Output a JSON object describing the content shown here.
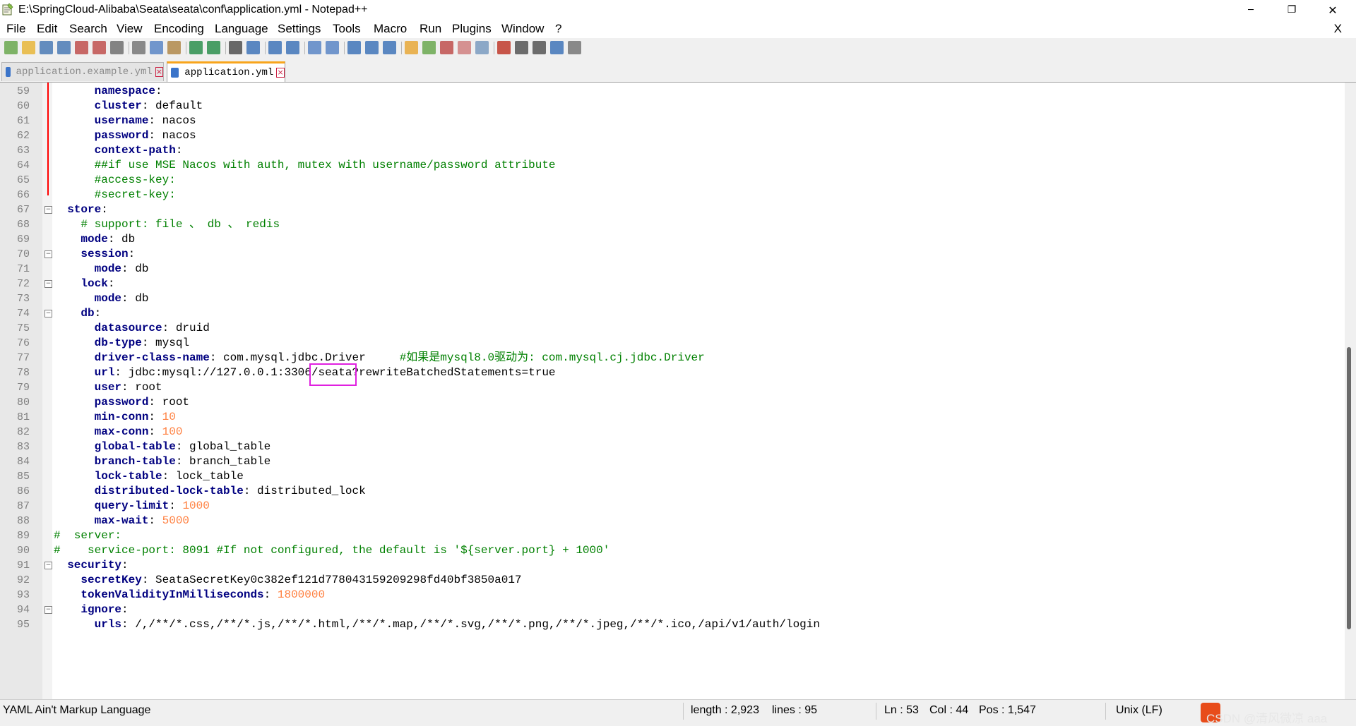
{
  "window": {
    "title": "E:\\SpringCloud-Alibaba\\Seata\\seata\\conf\\application.yml - Notepad++",
    "minimize_glyph": "─",
    "restore_glyph": "❐",
    "close_glyph": "✕"
  },
  "menu": {
    "items": [
      "File",
      "Edit",
      "Search",
      "View",
      "Encoding",
      "Language",
      "Settings",
      "Tools",
      "Macro",
      "Run",
      "Plugins",
      "Window",
      "?"
    ],
    "close_label": "X"
  },
  "toolbar": {
    "icons": [
      "new-file-icon",
      "open-file-icon",
      "save-icon",
      "save-all-icon",
      "close-icon",
      "close-all-icon",
      "print-icon",
      "cut-icon",
      "copy-icon",
      "paste-icon",
      "undo-icon",
      "redo-icon",
      "find-icon",
      "replace-icon",
      "zoom-in-icon",
      "zoom-out-icon",
      "sync-vertical-icon",
      "sync-horizontal-icon",
      "word-wrap-icon",
      "show-all-chars-icon",
      "indent-guide-icon",
      "user-language-icon",
      "document-map-icon",
      "function-list-icon",
      "folder-workspace-icon",
      "monitoring-icon",
      "record-macro-icon",
      "stop-macro-icon",
      "play-macro-icon",
      "run-macro-multiple-icon",
      "save-macro-icon"
    ]
  },
  "tabs": [
    {
      "label": "application.example.yml",
      "active": false
    },
    {
      "label": "application.yml",
      "active": true
    }
  ],
  "tab_close_glyph": "×",
  "fold_minus": "−",
  "lines": [
    {
      "n": "59",
      "segs": [
        {
          "t": "      "
        },
        {
          "t": "namespace",
          "c": "k"
        },
        {
          "t": ":"
        }
      ]
    },
    {
      "n": "60",
      "segs": [
        {
          "t": "      "
        },
        {
          "t": "cluster",
          "c": "k"
        },
        {
          "t": ": default"
        }
      ]
    },
    {
      "n": "61",
      "segs": [
        {
          "t": "      "
        },
        {
          "t": "username",
          "c": "k"
        },
        {
          "t": ": nacos"
        }
      ]
    },
    {
      "n": "62",
      "segs": [
        {
          "t": "      "
        },
        {
          "t": "password",
          "c": "k"
        },
        {
          "t": ": nacos"
        }
      ]
    },
    {
      "n": "63",
      "segs": [
        {
          "t": "      "
        },
        {
          "t": "context-path",
          "c": "k"
        },
        {
          "t": ":"
        }
      ]
    },
    {
      "n": "64",
      "segs": [
        {
          "t": "      "
        },
        {
          "t": "##if use MSE Nacos with auth, mutex with username/password attribute",
          "c": "c"
        }
      ]
    },
    {
      "n": "65",
      "segs": [
        {
          "t": "      "
        },
        {
          "t": "#access-key:",
          "c": "c"
        }
      ]
    },
    {
      "n": "66",
      "segs": [
        {
          "t": "      "
        },
        {
          "t": "#secret-key:",
          "c": "c"
        }
      ]
    },
    {
      "n": "67",
      "segs": [
        {
          "t": "  "
        },
        {
          "t": "store",
          "c": "k"
        },
        {
          "t": ":"
        }
      ]
    },
    {
      "n": "68",
      "segs": [
        {
          "t": "    "
        },
        {
          "t": "# support: file 、 db 、 redis",
          "c": "c"
        }
      ]
    },
    {
      "n": "69",
      "segs": [
        {
          "t": "    "
        },
        {
          "t": "mode",
          "c": "k"
        },
        {
          "t": ": db"
        }
      ]
    },
    {
      "n": "70",
      "segs": [
        {
          "t": "    "
        },
        {
          "t": "session",
          "c": "k"
        },
        {
          "t": ":"
        }
      ]
    },
    {
      "n": "71",
      "segs": [
        {
          "t": "      "
        },
        {
          "t": "mode",
          "c": "k"
        },
        {
          "t": ": db"
        }
      ]
    },
    {
      "n": "72",
      "segs": [
        {
          "t": "    "
        },
        {
          "t": "lock",
          "c": "k"
        },
        {
          "t": ":"
        }
      ]
    },
    {
      "n": "73",
      "segs": [
        {
          "t": "      "
        },
        {
          "t": "mode",
          "c": "k"
        },
        {
          "t": ": db"
        }
      ]
    },
    {
      "n": "74",
      "segs": [
        {
          "t": "    "
        },
        {
          "t": "db",
          "c": "k"
        },
        {
          "t": ":"
        }
      ]
    },
    {
      "n": "75",
      "segs": [
        {
          "t": "      "
        },
        {
          "t": "datasource",
          "c": "k"
        },
        {
          "t": ": druid"
        }
      ]
    },
    {
      "n": "76",
      "segs": [
        {
          "t": "      "
        },
        {
          "t": "db-type",
          "c": "k"
        },
        {
          "t": ": mysql"
        }
      ]
    },
    {
      "n": "77",
      "segs": [
        {
          "t": "      "
        },
        {
          "t": "driver-class-name",
          "c": "k"
        },
        {
          "t": ": com.mysql.jdbc.Driver     "
        },
        {
          "t": "#如果是mysql8.0驱动为: com.mysql.cj.jdbc.Driver",
          "c": "c"
        }
      ]
    },
    {
      "n": "78",
      "segs": [
        {
          "t": "      "
        },
        {
          "t": "url",
          "c": "k"
        },
        {
          "t": ": jdbc:mysql://127.0.0.1:3306/seata?rewriteBatchedStatements=true"
        }
      ]
    },
    {
      "n": "79",
      "segs": [
        {
          "t": "      "
        },
        {
          "t": "user",
          "c": "k"
        },
        {
          "t": ": root"
        }
      ]
    },
    {
      "n": "80",
      "segs": [
        {
          "t": "      "
        },
        {
          "t": "password",
          "c": "k"
        },
        {
          "t": ": root"
        }
      ]
    },
    {
      "n": "81",
      "segs": [
        {
          "t": "      "
        },
        {
          "t": "min-conn",
          "c": "k"
        },
        {
          "t": ": "
        },
        {
          "t": "10",
          "c": "n"
        }
      ]
    },
    {
      "n": "82",
      "segs": [
        {
          "t": "      "
        },
        {
          "t": "max-conn",
          "c": "k"
        },
        {
          "t": ": "
        },
        {
          "t": "100",
          "c": "n"
        }
      ]
    },
    {
      "n": "83",
      "segs": [
        {
          "t": "      "
        },
        {
          "t": "global-table",
          "c": "k"
        },
        {
          "t": ": global_table"
        }
      ]
    },
    {
      "n": "84",
      "segs": [
        {
          "t": "      "
        },
        {
          "t": "branch-table",
          "c": "k"
        },
        {
          "t": ": branch_table"
        }
      ]
    },
    {
      "n": "85",
      "segs": [
        {
          "t": "      "
        },
        {
          "t": "lock-table",
          "c": "k"
        },
        {
          "t": ": lock_table"
        }
      ]
    },
    {
      "n": "86",
      "segs": [
        {
          "t": "      "
        },
        {
          "t": "distributed-lock-table",
          "c": "k"
        },
        {
          "t": ": distributed_lock"
        }
      ]
    },
    {
      "n": "87",
      "segs": [
        {
          "t": "      "
        },
        {
          "t": "query-limit",
          "c": "k"
        },
        {
          "t": ": "
        },
        {
          "t": "1000",
          "c": "n"
        }
      ]
    },
    {
      "n": "88",
      "segs": [
        {
          "t": "      "
        },
        {
          "t": "max-wait",
          "c": "k"
        },
        {
          "t": ": "
        },
        {
          "t": "5000",
          "c": "n"
        }
      ]
    },
    {
      "n": "89",
      "segs": [
        {
          "t": "#  server:",
          "c": "c"
        }
      ]
    },
    {
      "n": "90",
      "segs": [
        {
          "t": "#    service-port: 8091 #If not configured, the default is '${server.port} + 1000'",
          "c": "c"
        }
      ]
    },
    {
      "n": "91",
      "segs": [
        {
          "t": "  "
        },
        {
          "t": "security",
          "c": "k"
        },
        {
          "t": ":"
        }
      ]
    },
    {
      "n": "92",
      "segs": [
        {
          "t": "    "
        },
        {
          "t": "secretKey",
          "c": "k"
        },
        {
          "t": ": SeataSecretKey0c382ef121d778043159209298fd40bf3850a017"
        }
      ]
    },
    {
      "n": "93",
      "segs": [
        {
          "t": "    "
        },
        {
          "t": "tokenValidityInMilliseconds",
          "c": "k"
        },
        {
          "t": ": "
        },
        {
          "t": "1800000",
          "c": "n"
        }
      ]
    },
    {
      "n": "94",
      "segs": [
        {
          "t": "    "
        },
        {
          "t": "ignore",
          "c": "k"
        },
        {
          "t": ":"
        }
      ]
    },
    {
      "n": "95",
      "segs": [
        {
          "t": "      "
        },
        {
          "t": "urls",
          "c": "k"
        },
        {
          "t": ": /,/**/*.css,/**/*.js,/**/*.html,/**/*.map,/**/*.svg,/**/*.png,/**/*.jpeg,/**/*.ico,/api/v1/auth/login"
        }
      ]
    }
  ],
  "status": {
    "language": "YAML Ain't Markup Language",
    "length": "length : 2,923",
    "lines": "lines : 95",
    "ln": "Ln : 53",
    "col": "Col : 44",
    "pos": "Pos : 1,547",
    "eol": "Unix (LF)",
    "watermark": "CSDN @清风微凉 aaa"
  },
  "colors": {
    "keyword": "#000080",
    "comment": "#008000",
    "number": "#ff8040",
    "highlight_box": "#e020e0",
    "active_tab_accent": "#f8a51c"
  }
}
